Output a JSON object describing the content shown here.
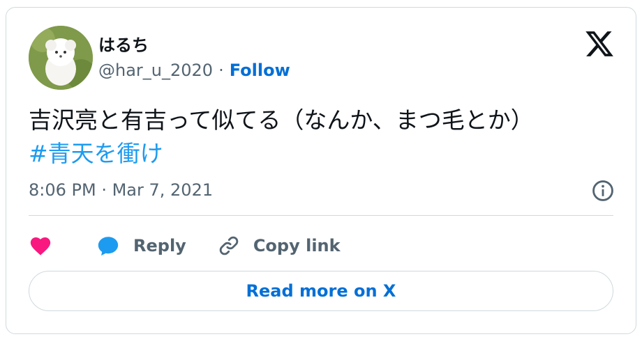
{
  "user": {
    "display_name": "はるち",
    "handle": "@har_u_2020",
    "separator": "·",
    "follow_label": "Follow"
  },
  "tweet": {
    "text": "吉沢亮と有吉って似てる（なんか、まつ毛とか）",
    "hashtag": "#青天を衝け",
    "timestamp": "8:06 PM · Mar 7, 2021"
  },
  "actions": {
    "like_icon": "heart-icon",
    "reply_label": "Reply",
    "copy_label": "Copy link"
  },
  "footer": {
    "read_more_label": "Read more on X"
  },
  "colors": {
    "link_blue": "#006fd6",
    "hashtag_blue": "#1d9bf0",
    "heart_pink": "#f91880",
    "muted_gray": "#536471",
    "border": "#cfd9de"
  }
}
